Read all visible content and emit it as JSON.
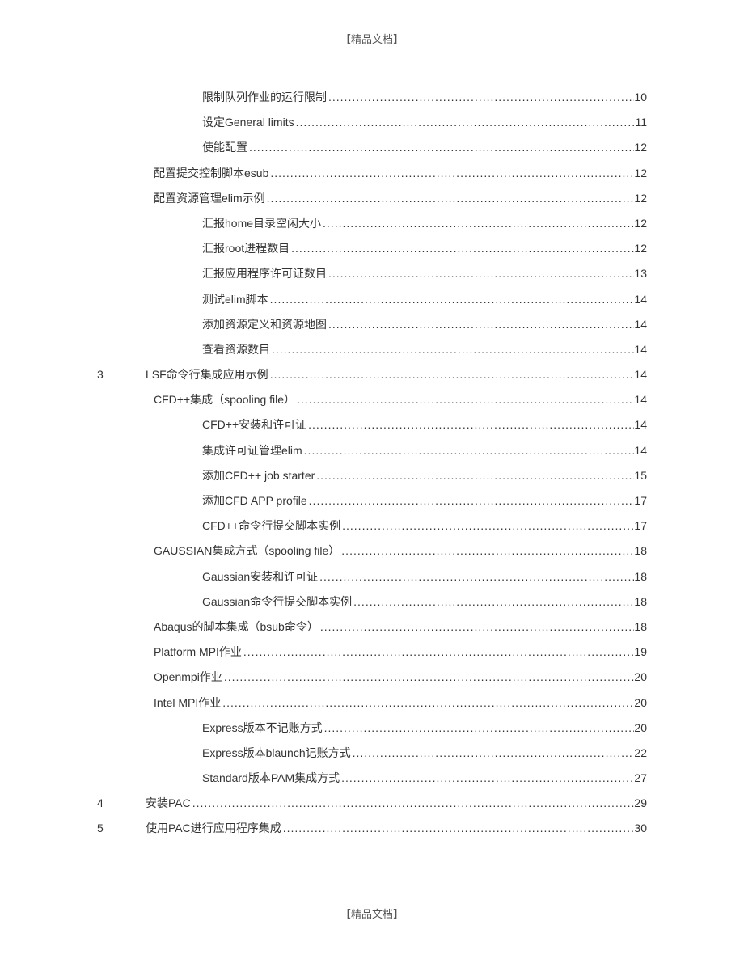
{
  "header_text": "【精品文档】",
  "footer_text": "【精品文档】",
  "toc": [
    {
      "num": "",
      "level": 3,
      "title": "限制队列作业的运行限制",
      "page": "10"
    },
    {
      "num": "",
      "level": 3,
      "title": "设定General limits",
      "page": "11"
    },
    {
      "num": "",
      "level": 3,
      "title": "使能配置",
      "page": "12"
    },
    {
      "num": "",
      "level": 2,
      "title": "配置提交控制脚本esub",
      "page": "12"
    },
    {
      "num": "",
      "level": 2,
      "title": "配置资源管理elim示例",
      "page": "12"
    },
    {
      "num": "",
      "level": 3,
      "title": "汇报home目录空闲大小",
      "page": "12"
    },
    {
      "num": "",
      "level": 3,
      "title": "汇报root进程数目",
      "page": "12"
    },
    {
      "num": "",
      "level": 3,
      "title": "汇报应用程序许可证数目",
      "page": "13"
    },
    {
      "num": "",
      "level": 3,
      "title": "测试elim脚本",
      "page": "14"
    },
    {
      "num": "",
      "level": 3,
      "title": "添加资源定义和资源地图",
      "page": "14"
    },
    {
      "num": "",
      "level": 3,
      "title": "查看资源数目",
      "page": "14"
    },
    {
      "num": "3",
      "level": 1,
      "title": "LSF命令行集成应用示例",
      "page": "14"
    },
    {
      "num": "",
      "level": 2,
      "title": "CFD++集成（spooling file）",
      "page": "14"
    },
    {
      "num": "",
      "level": 3,
      "title": "CFD++安装和许可证",
      "page": "14"
    },
    {
      "num": "",
      "level": 3,
      "title": "集成许可证管理elim",
      "page": "14"
    },
    {
      "num": "",
      "level": 3,
      "title": "添加CFD++ job starter",
      "page": "15"
    },
    {
      "num": "",
      "level": 3,
      "title": "添加CFD APP profile",
      "page": "17"
    },
    {
      "num": "",
      "level": 3,
      "title": "CFD++命令行提交脚本实例",
      "page": "17"
    },
    {
      "num": "",
      "level": 2,
      "title": "GAUSSIAN集成方式（spooling file）",
      "page": "18"
    },
    {
      "num": "",
      "level": 3,
      "title": "Gaussian安装和许可证",
      "page": "18"
    },
    {
      "num": "",
      "level": 3,
      "title": "Gaussian命令行提交脚本实例",
      "page": "18"
    },
    {
      "num": "",
      "level": 2,
      "title": "Abaqus的脚本集成（bsub命令）",
      "page": "18"
    },
    {
      "num": "",
      "level": 2,
      "title": "Platform MPI作业",
      "page": "19"
    },
    {
      "num": "",
      "level": 2,
      "title": "Openmpi作业",
      "page": "20"
    },
    {
      "num": "",
      "level": 2,
      "title": "Intel MPI作业",
      "page": "20"
    },
    {
      "num": "",
      "level": 3,
      "title": "Express版本不记账方式",
      "page": "20"
    },
    {
      "num": "",
      "level": 3,
      "title": "Express版本blaunch记账方式",
      "page": "22"
    },
    {
      "num": "",
      "level": 3,
      "title": "Standard版本PAM集成方式",
      "page": "27"
    },
    {
      "num": "4",
      "level": 1,
      "title": "安装PAC",
      "page": "29"
    },
    {
      "num": "5",
      "level": 1,
      "title": "使用PAC进行应用程序集成",
      "page": "30"
    }
  ]
}
